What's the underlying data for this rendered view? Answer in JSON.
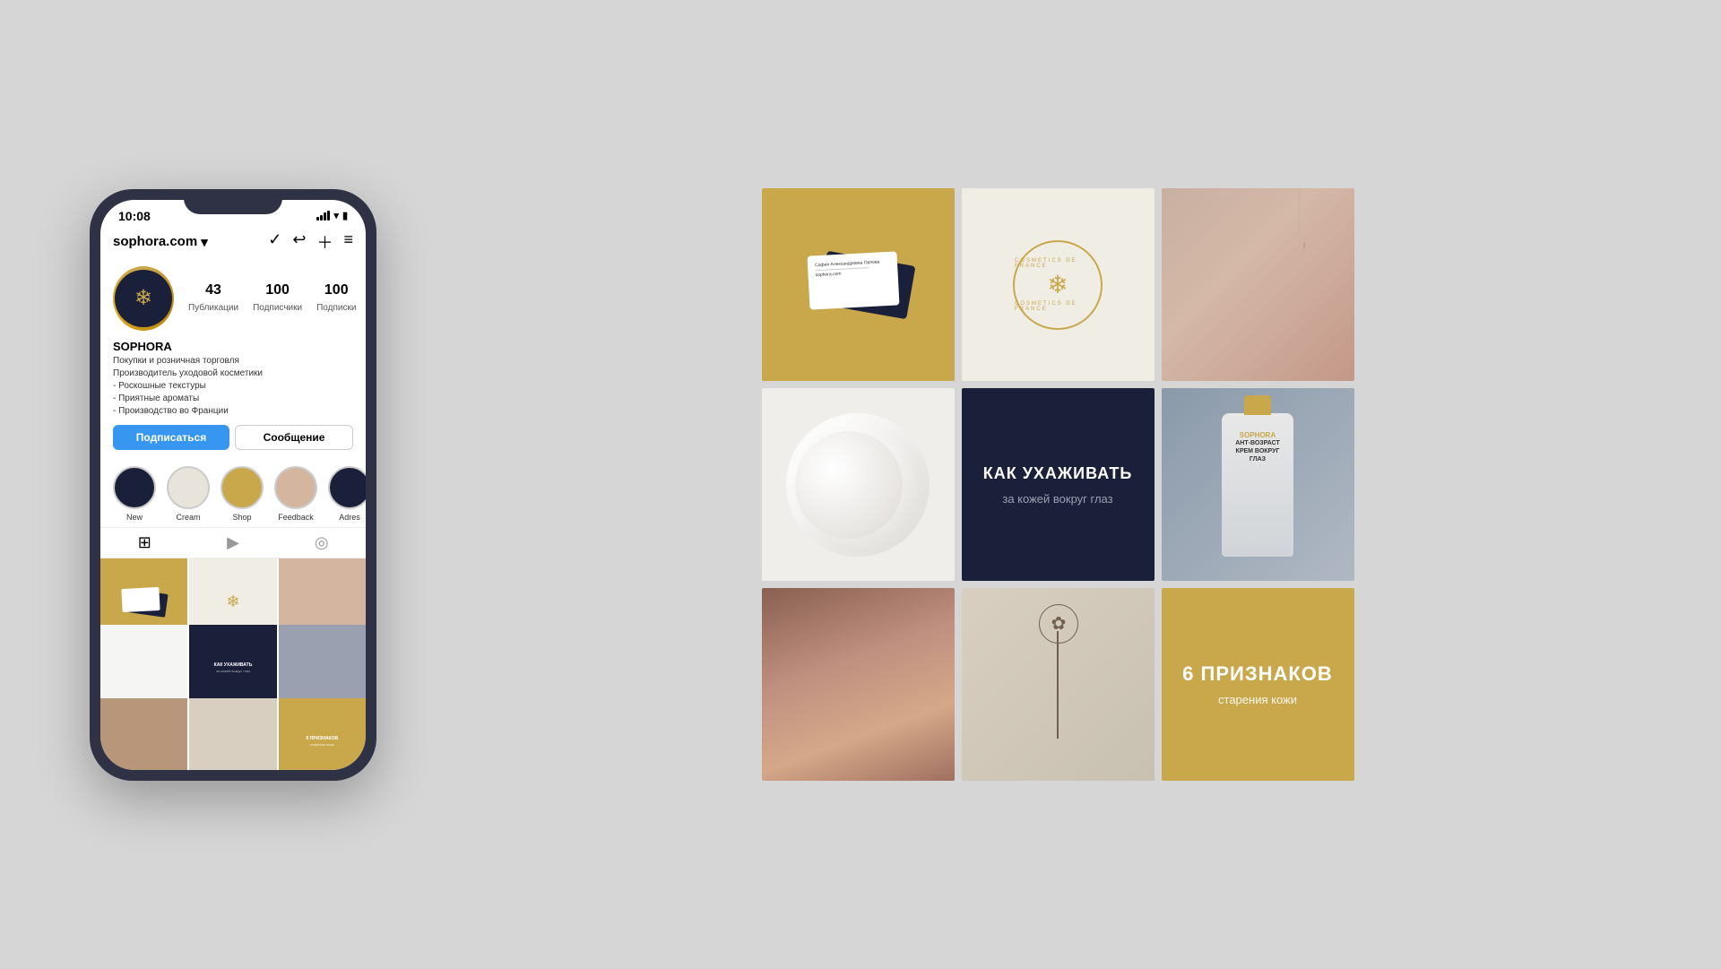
{
  "page": {
    "background": "#d6d6d6"
  },
  "phone": {
    "time": "10:08",
    "username": "sophora.com",
    "stats": {
      "posts": "43",
      "posts_label": "Публикации",
      "followers": "100",
      "followers_label": "Подписчики",
      "following": "100",
      "following_label": "Подписки"
    },
    "profile_name": "SOPHORA",
    "profile_desc_line1": "Покупки и розничная торговля",
    "profile_desc_line2": "Производитель уходовой косметики",
    "profile_desc_line3": "- Роскошные текстуры",
    "profile_desc_line4": "- Приятные ароматы",
    "profile_desc_line5": "- Производство во Франции",
    "btn_subscribe": "Подписаться",
    "btn_message": "Сообщение",
    "highlights": [
      {
        "label": "New",
        "style": "dark"
      },
      {
        "label": "Cream",
        "style": "cream"
      },
      {
        "label": "Shop",
        "style": "gold"
      },
      {
        "label": "Feedback",
        "style": "face"
      },
      {
        "label": "Adres",
        "style": "dark2"
      }
    ]
  },
  "grid": {
    "cell5": {
      "title": "КАК УХАЖИВАТЬ",
      "subtitle": "за кожей вокруг глаз"
    },
    "cell9": {
      "title": "6 ПРИЗНАКОВ",
      "subtitle": "старения кожи"
    },
    "logo_text_top": "COSMETICS DE FRANCE",
    "logo_text_bottom": "COSMETICS DE FRANCE",
    "brand_name": "SOPHORA"
  }
}
